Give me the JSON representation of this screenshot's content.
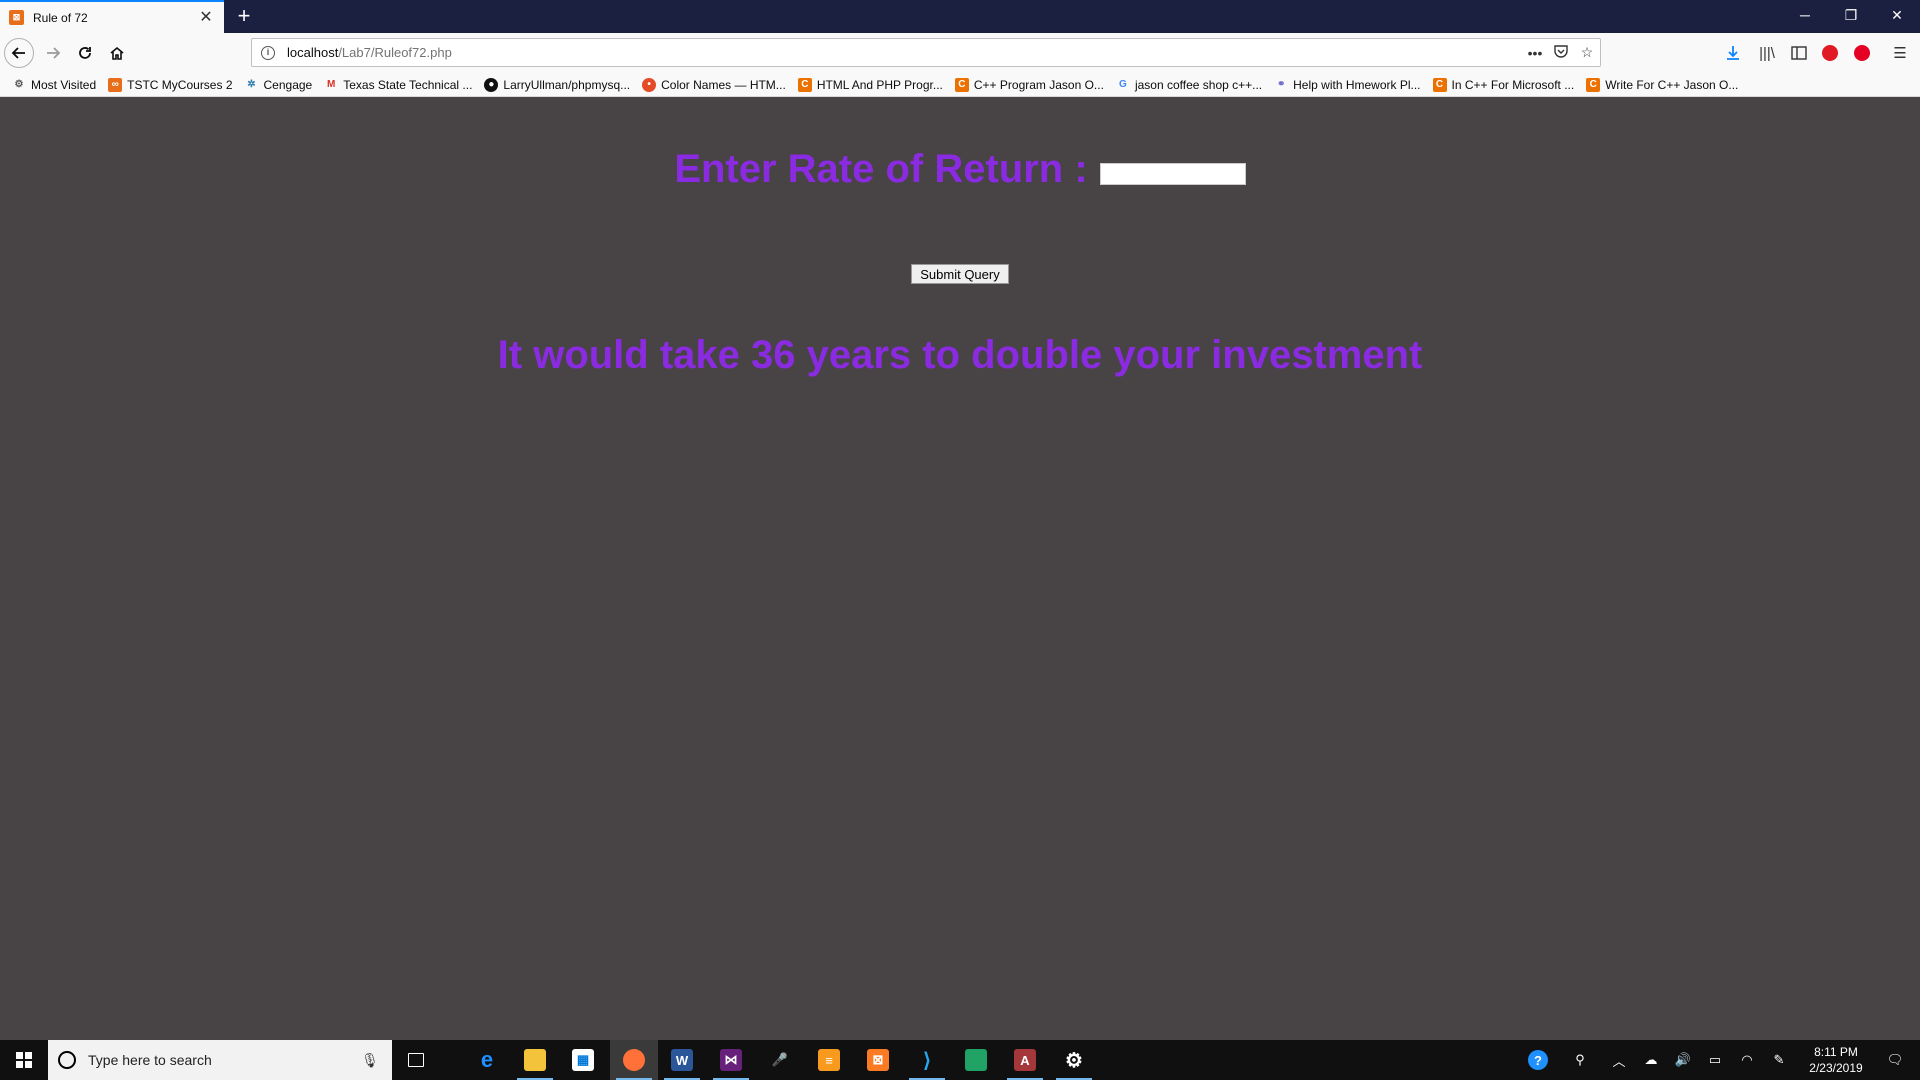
{
  "browser": {
    "tab_title": "Rule of 72",
    "url_host": "localhost",
    "url_path": "/Lab7/Ruleof72.php"
  },
  "bookmarks": [
    {
      "label": "Most Visited",
      "icon": "gear-icon",
      "color": "#555555"
    },
    {
      "label": "TSTC MyCourses 2",
      "icon": "d2l-icon",
      "color": "#e76f1c"
    },
    {
      "label": "Cengage",
      "icon": "cengage-icon",
      "color": "#2a7ab0"
    },
    {
      "label": "Texas State Technical ...",
      "icon": "gmail-icon",
      "color": "#d93025"
    },
    {
      "label": "LarryUllman/phpmysq...",
      "icon": "github-icon",
      "color": "#111111"
    },
    {
      "label": "Color Names — HTM...",
      "icon": "colors-icon",
      "color": "#e34c26"
    },
    {
      "label": "HTML And PHP Progr...",
      "icon": "chegg-icon",
      "color": "#eb7100"
    },
    {
      "label": "C++ Program Jason O...",
      "icon": "chegg-icon",
      "color": "#eb7100"
    },
    {
      "label": "jason coffee shop c++...",
      "icon": "google-icon",
      "color": "#4285f4"
    },
    {
      "label": "Help with Hmework Pl...",
      "icon": "forum-icon",
      "color": "#6b6bcc"
    },
    {
      "label": "In C++ For Microsoft ...",
      "icon": "chegg-icon",
      "color": "#eb7100"
    },
    {
      "label": "Write For C++ Jason O...",
      "icon": "chegg-icon",
      "color": "#eb7100"
    }
  ],
  "page": {
    "heading": "Enter Rate of Return :",
    "rate_input_value": "",
    "submit_label": "Submit Query",
    "result": "It would take 36 years to double your investment",
    "accent_color": "#8a2be2",
    "background_color": "#484344"
  },
  "taskbar": {
    "search_placeholder": "Type here to search",
    "apps": [
      "task-view-icon",
      "edge-icon",
      "file-explorer-icon",
      "store-icon",
      "firefox-icon",
      "word-icon",
      "visual-studio-icon",
      "voice-recorder-icon",
      "sublime-icon",
      "xampp-icon",
      "vscode-icon",
      "notepad-icon",
      "access-icon",
      "settings-icon"
    ],
    "time": "8:11 PM",
    "date": "2/23/2019"
  }
}
